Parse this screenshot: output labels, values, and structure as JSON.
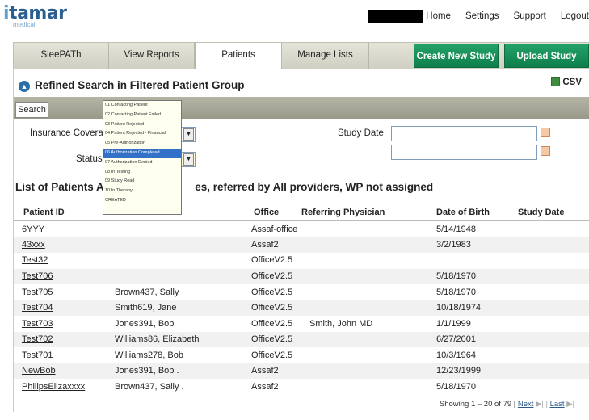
{
  "logo": {
    "name": "itamar",
    "sub": "medical"
  },
  "topnav": {
    "home": "Home",
    "settings": "Settings",
    "support": "Support",
    "logout": "Logout"
  },
  "tabs": [
    "SleePATh",
    "View Reports",
    "Patients",
    "Manage Lists"
  ],
  "buttons": {
    "create_study": "Create New Study",
    "upload_study": "Upload Study"
  },
  "section": {
    "title": "Refined Search in Filtered Patient Group",
    "csv": "CSV"
  },
  "search": {
    "button": "Search",
    "insurance_label": "Insurance Coverage",
    "status_label": "Status",
    "study_date_label": "Study Date"
  },
  "status_options": [
    "01 Contacting Patient",
    "02 Contacting Patient Failed",
    "03 Patient Rejected",
    "04 Patient Rejected - Financial",
    "05 Pre-Authorization",
    "06 Authorization Completed",
    "07 Authorization Denied",
    "08 In Testing",
    "09 Study Read",
    "10 In Therapy",
    "CREATED"
  ],
  "list": {
    "title_start": "List of Patients All ti",
    "title_end": "es, referred by All providers, WP not assigned",
    "columns": [
      "Patient ID",
      "Office",
      "Referring Physician",
      "Date of Birth",
      "Study Date"
    ],
    "rows": [
      {
        "id": "6YYY",
        "name": "",
        "office": "Assaf-office",
        "physician": "",
        "dob": "5/14/1948",
        "study": ""
      },
      {
        "id": "43xxx",
        "name": "",
        "office": "Assaf2",
        "physician": "",
        "dob": "3/2/1983",
        "study": ""
      },
      {
        "id": "Test32",
        "name": ".",
        "office": "OfficeV2.5",
        "physician": "",
        "dob": "",
        "study": ""
      },
      {
        "id": "Test706",
        "name": "",
        "office": "OfficeV2.5",
        "physician": "",
        "dob": "5/18/1970",
        "study": ""
      },
      {
        "id": "Test705",
        "name": "Brown437, Sally",
        "office": "OfficeV2.5",
        "physician": "",
        "dob": "5/18/1970",
        "study": ""
      },
      {
        "id": "Test704",
        "name": "Smith619, Jane",
        "office": "OfficeV2.5",
        "physician": "",
        "dob": "10/18/1974",
        "study": ""
      },
      {
        "id": "Test703",
        "name": "Jones391, Bob",
        "office": "OfficeV2.5",
        "physician": "Smith, John MD",
        "dob": "1/1/1999",
        "study": ""
      },
      {
        "id": "Test702",
        "name": "Williams86, Elizabeth",
        "office": "OfficeV2.5",
        "physician": "",
        "dob": "6/27/2001",
        "study": ""
      },
      {
        "id": "Test701",
        "name": "Williams278, Bob",
        "office": "OfficeV2.5",
        "physician": "",
        "dob": "10/3/1964",
        "study": ""
      },
      {
        "id": "NewBob",
        "name": "Jones391, Bob .",
        "office": "Assaf2",
        "physician": "",
        "dob": "12/23/1999",
        "study": ""
      },
      {
        "id": "PhilipsElizaxxxx",
        "name": "Brown437, Sally .",
        "office": "Assaf2",
        "physician": "",
        "dob": "5/18/1970",
        "study": ""
      }
    ]
  },
  "pager": {
    "showing": "Showing 1 – 20 of 79 |",
    "next": "Next",
    "last": "Last"
  }
}
